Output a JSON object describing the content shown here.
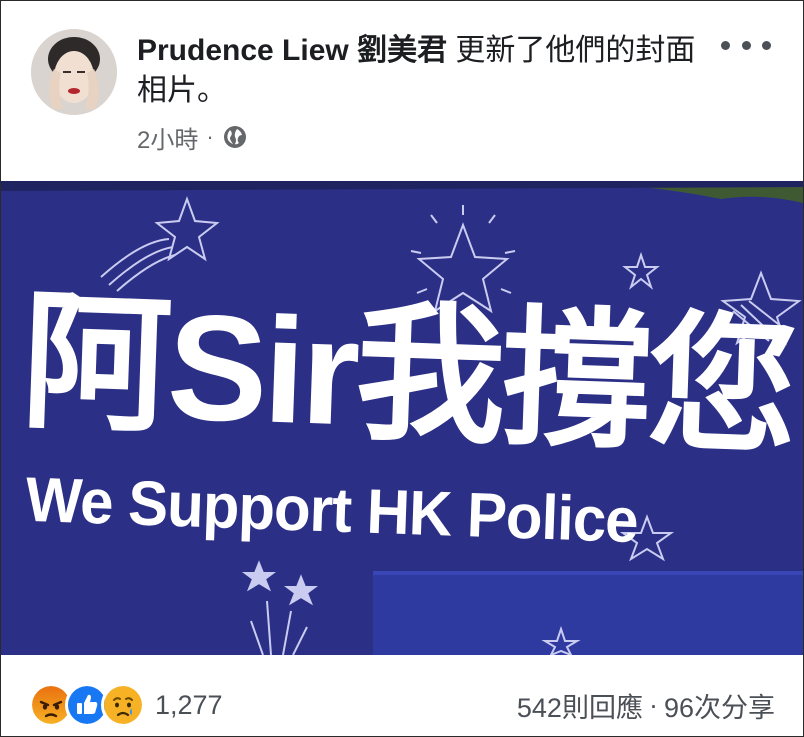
{
  "post": {
    "author": "Prudence Liew 劉美君",
    "action": "更新了他們的封面相片。",
    "time": "2小時",
    "meta_separator": "·",
    "privacy_icon": "globe-icon"
  },
  "cover": {
    "banner_zh": "阿Sir我撐您",
    "banner_en": "We Support HK Police",
    "background_color": "#2b2f86"
  },
  "footer": {
    "reaction_icons": [
      "angry-reaction-icon",
      "like-reaction-icon",
      "sad-reaction-icon"
    ],
    "reaction_count": "1,277",
    "comments": "542則回應",
    "separator": "·",
    "shares": "96次分享"
  },
  "colors": {
    "name": "#1c1e21",
    "meta": "#65676b",
    "like_blue": "#1877f2",
    "angry_orange": "#e9710f",
    "sad_yellow": "#f7b125"
  }
}
